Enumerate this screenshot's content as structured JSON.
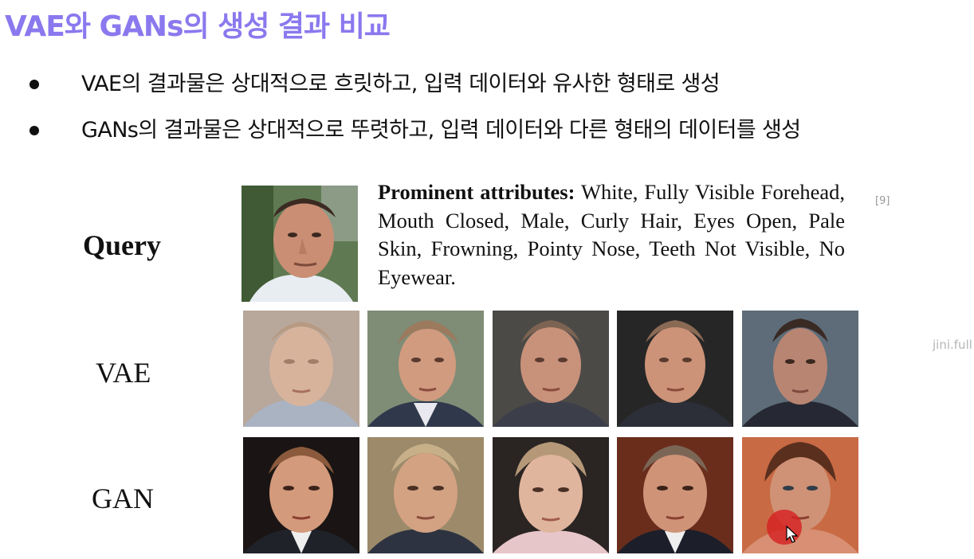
{
  "slide": {
    "title": "VAE와 GANs의 생성 결과 비교",
    "title_color": "#8a79ee",
    "bullets": [
      "VAE의 결과물은 상대적으로 흐릿하고, 입력 데이터와 유사한 형태로 생성",
      "GANs의 결과물은 상대적으로 뚜렷하고, 입력 데이터와 다른 형태의 데이터를 생성"
    ]
  },
  "figure": {
    "rows": {
      "query": "Query",
      "vae": "VAE",
      "gan": "GAN"
    },
    "attributes_label": "Prominent attributes:",
    "attributes_text": " White, Fully Visible Forehead, Mouth Closed, Male, Curly Hair, Eyes Open, Pale Skin, Frowning, Pointy Nose, Teeth Not Visible, No Eyewear.",
    "citation": "[9]"
  },
  "watermark": "jini.full"
}
